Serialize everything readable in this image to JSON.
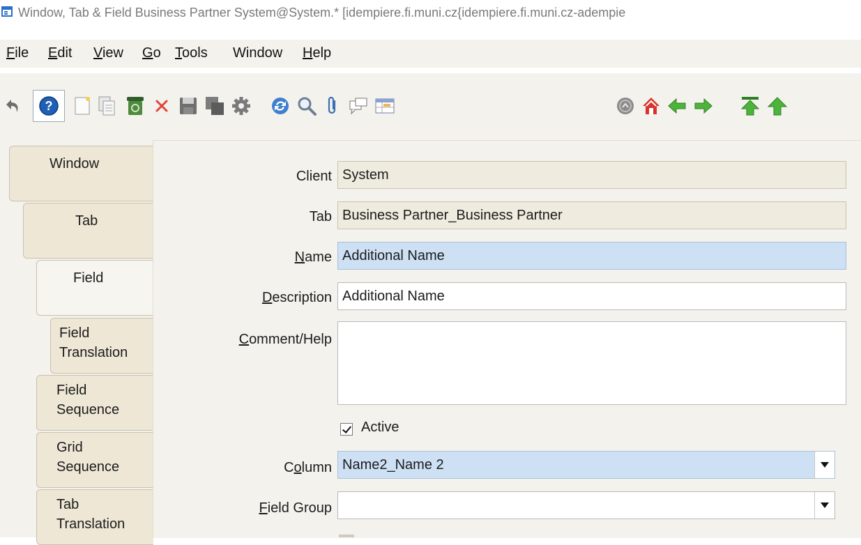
{
  "window": {
    "title": "Window, Tab & Field  Business Partner  System@System.* [idempiere.fi.muni.cz{idempiere.fi.muni.cz-adempie"
  },
  "menu": {
    "items": [
      {
        "label": "File",
        "mnemonic": "F",
        "rest": "ile"
      },
      {
        "label": "Edit",
        "mnemonic": "E",
        "rest": "dit"
      },
      {
        "label": "View",
        "mnemonic": "V",
        "rest": "iew"
      },
      {
        "label": "Go",
        "mnemonic": "G",
        "rest": "o"
      },
      {
        "label": "Tools",
        "mnemonic": "T",
        "rest": "ools"
      },
      {
        "label": "Window",
        "mnemonic": "",
        "rest": "Window"
      },
      {
        "label": "Help",
        "mnemonic": "H",
        "rest": "elp"
      }
    ]
  },
  "toolbar": {
    "icons": [
      "undo-icon",
      "help-icon",
      "new-record-icon",
      "copy-record-icon",
      "delete-icon",
      "delete-selection-icon",
      "save-icon",
      "save-and-create-icon",
      "process-icon",
      "refresh-icon",
      "find-icon",
      "attachment-icon",
      "chat-icon",
      "grid-toggle-icon",
      "history-icon",
      "home-icon",
      "previous-icon",
      "next-icon",
      "first-record-icon",
      "parent-record-icon"
    ]
  },
  "tabs": [
    {
      "label_lines": [
        "Window"
      ],
      "active": false
    },
    {
      "label_lines": [
        "Tab"
      ],
      "active": false
    },
    {
      "label_lines": [
        "Field"
      ],
      "active": true
    },
    {
      "label_lines": [
        "Field",
        "Translation"
      ],
      "active": false
    },
    {
      "label_lines": [
        "Field",
        "Sequence"
      ],
      "active": false
    },
    {
      "label_lines": [
        "Grid",
        "Sequence"
      ],
      "active": false
    },
    {
      "label_lines": [
        "Tab",
        "Translation"
      ],
      "active": false
    }
  ],
  "form": {
    "client": {
      "label": "Client",
      "value": "System"
    },
    "tab": {
      "label": "Tab",
      "value": "Business Partner_Business Partner"
    },
    "name": {
      "label_mn": "N",
      "label_rest": "ame",
      "value": "Additional Name"
    },
    "description": {
      "label_mn": "D",
      "label_rest": "escription",
      "value": "Additional Name"
    },
    "comment_help": {
      "label_mn": "C",
      "label_rest": "omment/Help",
      "value": ""
    },
    "active": {
      "label": "Active",
      "checked": true
    },
    "column": {
      "label_pre": "C",
      "label_mn": "o",
      "label_rest": "lumn",
      "value": "Name2_Name 2"
    },
    "field_group": {
      "label_mn": "F",
      "label_rest": "ield Group",
      "value": ""
    }
  },
  "colors": {
    "mandatory_bg": "#cde0f4",
    "readonly_bg": "#efebdf",
    "panel_bg": "#f4f2ed"
  }
}
